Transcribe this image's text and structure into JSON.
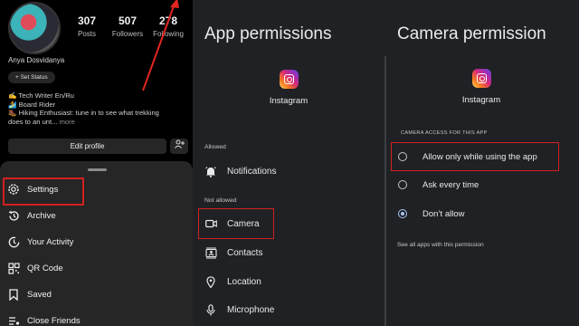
{
  "profile": {
    "stats": [
      {
        "num": "307",
        "label": "Posts"
      },
      {
        "num": "507",
        "label": "Followers"
      },
      {
        "num": "278",
        "label": "Following"
      }
    ],
    "username": "Anya Dosvidanya",
    "status_button": "+  Set Status",
    "bio": [
      "✍️ Tech Writer En/Ru",
      "🏄 Board Rider",
      "🥾 Hiking Enthusiast: tune in to see what trekking"
    ],
    "bio_last": "does to an unt...",
    "bio_more": "more",
    "edit_profile": "Edit profile",
    "menu": [
      {
        "label": "Settings",
        "icon": "gear-icon"
      },
      {
        "label": "Archive",
        "icon": "archive-history-icon"
      },
      {
        "label": "Your Activity",
        "icon": "activity-clock-icon"
      },
      {
        "label": "QR Code",
        "icon": "qr-code-icon"
      },
      {
        "label": "Saved",
        "icon": "bookmark-icon"
      },
      {
        "label": "Close Friends",
        "icon": "close-friends-list-icon"
      }
    ]
  },
  "app_permissions": {
    "title": "App permissions",
    "app_name": "Instagram",
    "allowed_label": "Allowed",
    "allowed": [
      {
        "label": "Notifications",
        "icon": "bell-icon"
      }
    ],
    "not_allowed_label": "Not allowed",
    "not_allowed": [
      {
        "label": "Camera",
        "icon": "video-camera-icon"
      },
      {
        "label": "Contacts",
        "icon": "contacts-icon"
      },
      {
        "label": "Location",
        "icon": "location-pin-icon"
      },
      {
        "label": "Microphone",
        "icon": "microphone-icon"
      }
    ]
  },
  "camera_permission": {
    "title": "Camera permission",
    "app_name": "Instagram",
    "caption": "CAMERA ACCESS FOR THIS APP",
    "options": [
      {
        "label": "Allow only while using the app",
        "selected": false
      },
      {
        "label": "Ask every time",
        "selected": false
      },
      {
        "label": "Don’t allow",
        "selected": true
      }
    ],
    "see_all": "See all apps with this permission"
  },
  "colors": {
    "highlight": "#d32020",
    "radio_selected": "#a8c7fa",
    "sheet_bg": "#262626",
    "settings_bg": "#202124"
  }
}
